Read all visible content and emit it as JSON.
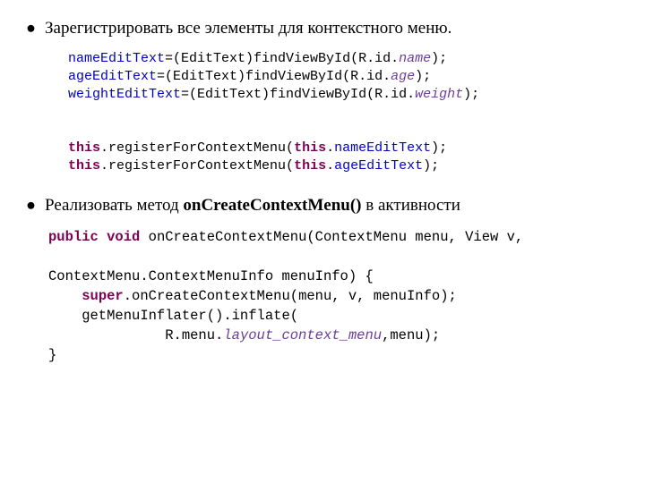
{
  "bullet1": "Зарегистрировать все элементы для контекстного меню.",
  "bullet2_pre": "Реализовать метод ",
  "bullet2_bold": "onCreateContextMenu()",
  "bullet2_post": " в активности",
  "code1": {
    "l1_a": "nameEditText",
    "l1_b": "=(EditText)findViewById(R.id.",
    "l1_c": "name",
    "l1_d": ");",
    "l2_a": "ageEditText",
    "l2_b": "=(EditText)findViewById(R.id.",
    "l2_c": "age",
    "l2_d": ");",
    "l3_a": "weightEditText",
    "l3_b": "=(EditText)findViewById(R.id.",
    "l3_c": "weight",
    "l3_d": ");",
    "l5_a": "this",
    "l5_b": ".registerForContextMenu(",
    "l5_c": "this",
    "l5_d": ".",
    "l5_e": "nameEditText",
    "l5_f": ");",
    "l6_a": "this",
    "l6_b": ".registerForContextMenu(",
    "l6_c": "this",
    "l6_d": ".",
    "l6_e": "ageEditText",
    "l6_f": ");"
  },
  "code2": {
    "l1_a": "public",
    "l1_b": " ",
    "l1_c": "void",
    "l1_d": " onCreateContextMenu(ContextMenu menu, View v,",
    "l2": "",
    "l3": "ContextMenu.ContextMenuInfo menuInfo) {",
    "l4_a": "    ",
    "l4_b": "super",
    "l4_c": ".onCreateContextMenu(menu, v, menuInfo);",
    "l5": "    getMenuInflater().inflate(",
    "l6_a": "              R.menu.",
    "l6_b": "layout_context_menu",
    "l6_c": ",menu);",
    "l7": "}"
  }
}
